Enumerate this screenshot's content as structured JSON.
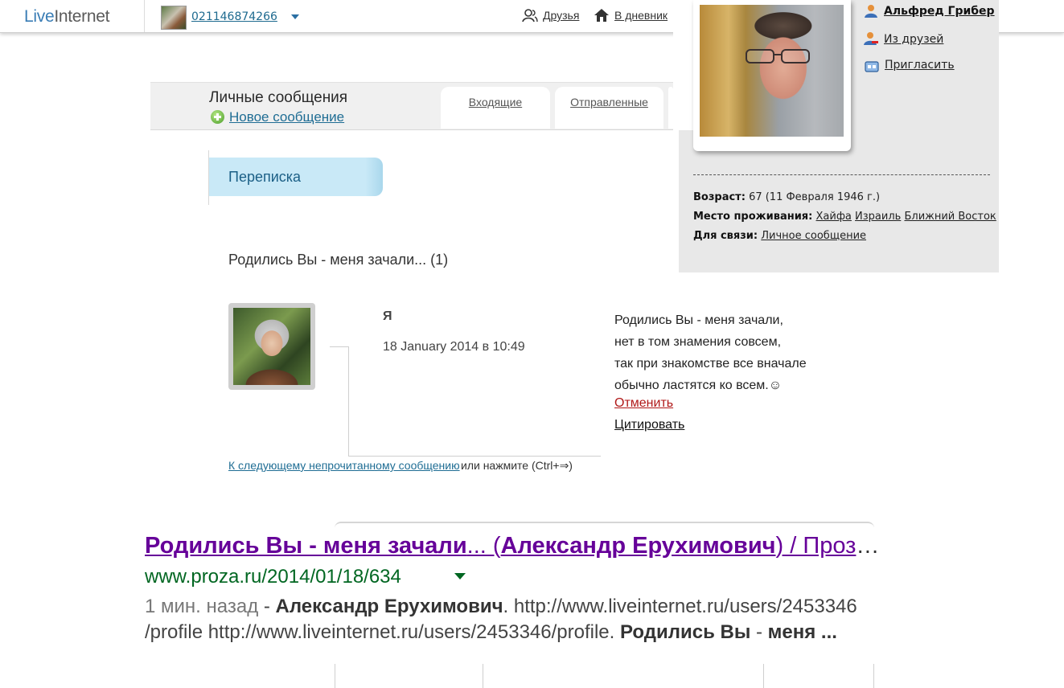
{
  "topbar": {
    "logo_part1": "Live",
    "logo_part2": "Internet",
    "username": "021146874266",
    "friends_label": "Друзья",
    "diary_label": "В дневник"
  },
  "messages": {
    "title": "Личные сообщения",
    "new_message": "Новое сообщение",
    "tabs": [
      {
        "label": "Входящие"
      },
      {
        "label": "Отправленные"
      }
    ],
    "section": "Переписка",
    "thread_title": "Родились Вы - меня зачали... (1)",
    "message": {
      "sender": "Я",
      "date": "18 January 2014 в 10:49",
      "lines": [
        "Родились Вы - меня зачали,",
        "нет в том знамения совсем,",
        "так при знакомстве все вначале",
        "обычно ластятся ко всем.☺"
      ],
      "cancel": "Отменить",
      "quote": "Цитировать"
    },
    "next_unread": "К следующему непрочитанному сообщению",
    "next_hint": "или нажмите (Ctrl+⇒)"
  },
  "profile": {
    "name": "Альфред Грибер",
    "remove_friend": "Из друзей",
    "invite": "Пригласить",
    "age_label": "Возраст:",
    "age_value": "67 (11 Февраля 1946 г.)",
    "residence_label": "Место проживания:",
    "residence": [
      "Хайфа",
      "Израиль",
      "Ближний Восток"
    ],
    "contact_label": "Для связи:",
    "contact_value": "Личное сообщение"
  },
  "search_result": {
    "title_main": "Родились Вы - меня зачали",
    "title_mid1": "... (",
    "title_author": "Александр Ерухимович",
    "title_rest": ") / Проз",
    "title_ellipsis": "…",
    "url": "www.proza.ru/2014/01/18/634",
    "snippet_ago": "1 мин. назад",
    "snippet_sep": " - ",
    "snippet_author": "Александр Ерухимович",
    "snippet_line1_rest": ". http://www.liveinternet.ru/users/2453346",
    "snippet_line2_a": "/profile http://www.liveinternet.ru/users/2453346/profile. ",
    "snippet_line2_b": "Родились Вы",
    "snippet_line2_c": " - ",
    "snippet_line2_d": "меня ..."
  },
  "colors": {
    "link_blue": "#1f6d94",
    "visited_purple": "#660099",
    "url_green": "#006621",
    "cancel_red": "#b01818",
    "section_bg": "#c9e9f7"
  },
  "icons": [
    "friends-icon",
    "home-icon",
    "plus-circle-icon",
    "user-icon",
    "remove-user-icon",
    "invite-icon",
    "caret-down-icon"
  ]
}
